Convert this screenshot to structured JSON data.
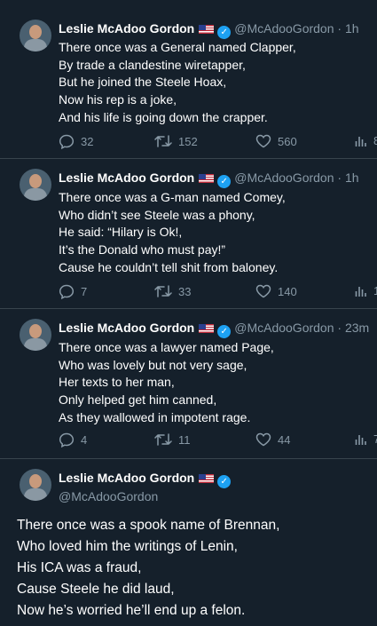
{
  "tweets": [
    {
      "name": "Leslie McAdoo Gordon",
      "handle": "@McAdooGordon",
      "time": "· 1h",
      "lines": [
        "There once was a General named Clapper,",
        "By trade a clandestine wiretapper,",
        "But he joined the Steele Hoax,",
        "Now his rep is a joke,",
        "And his life is going down the crapper."
      ],
      "replies": "32",
      "retweets": "152",
      "likes": "560",
      "analytics": "8"
    },
    {
      "name": "Leslie McAdoo Gordon",
      "handle": "@McAdooGordon",
      "time": "· 1h",
      "lines": [
        "There once was a G-man named Comey,",
        "Who didn’t see Steele was a phony,",
        "He said: “Hilary is Ok!,",
        "It’s the Donald who must pay!”",
        "Cause he couldn’t tell shit from baloney."
      ],
      "replies": "7",
      "retweets": "33",
      "likes": "140",
      "analytics": "1"
    },
    {
      "name": "Leslie McAdoo Gordon",
      "handle": "@McAdooGordon",
      "time": "· 23m",
      "lines": [
        "There once was a lawyer named Page,",
        "Who was lovely but not very sage,",
        "Her texts to her man,",
        "Only helped get him canned,",
        "As they wallowed in impotent rage."
      ],
      "replies": "4",
      "retweets": "11",
      "likes": "44",
      "analytics": "7"
    }
  ],
  "main_tweet": {
    "name": "Leslie McAdoo Gordon",
    "handle": "@McAdooGordon",
    "lines": [
      "There once was a spook name of Brennan,",
      "Who loved him the writings of Lenin,",
      "His ICA was a fraud,",
      "Cause Steele he did laud,",
      "Now he’s worried he’ll end up a felon."
    ]
  },
  "icons": {
    "reply": "reply-icon",
    "retweet": "retweet-icon",
    "like": "heart-icon",
    "analytics": "analytics-icon",
    "verified": "verified-badge-icon",
    "flag": "us-flag-icon"
  },
  "colors": {
    "background": "#15202b",
    "secondary_text": "#8899a6",
    "separator": "#38444d",
    "verified": "#1da1f2"
  }
}
